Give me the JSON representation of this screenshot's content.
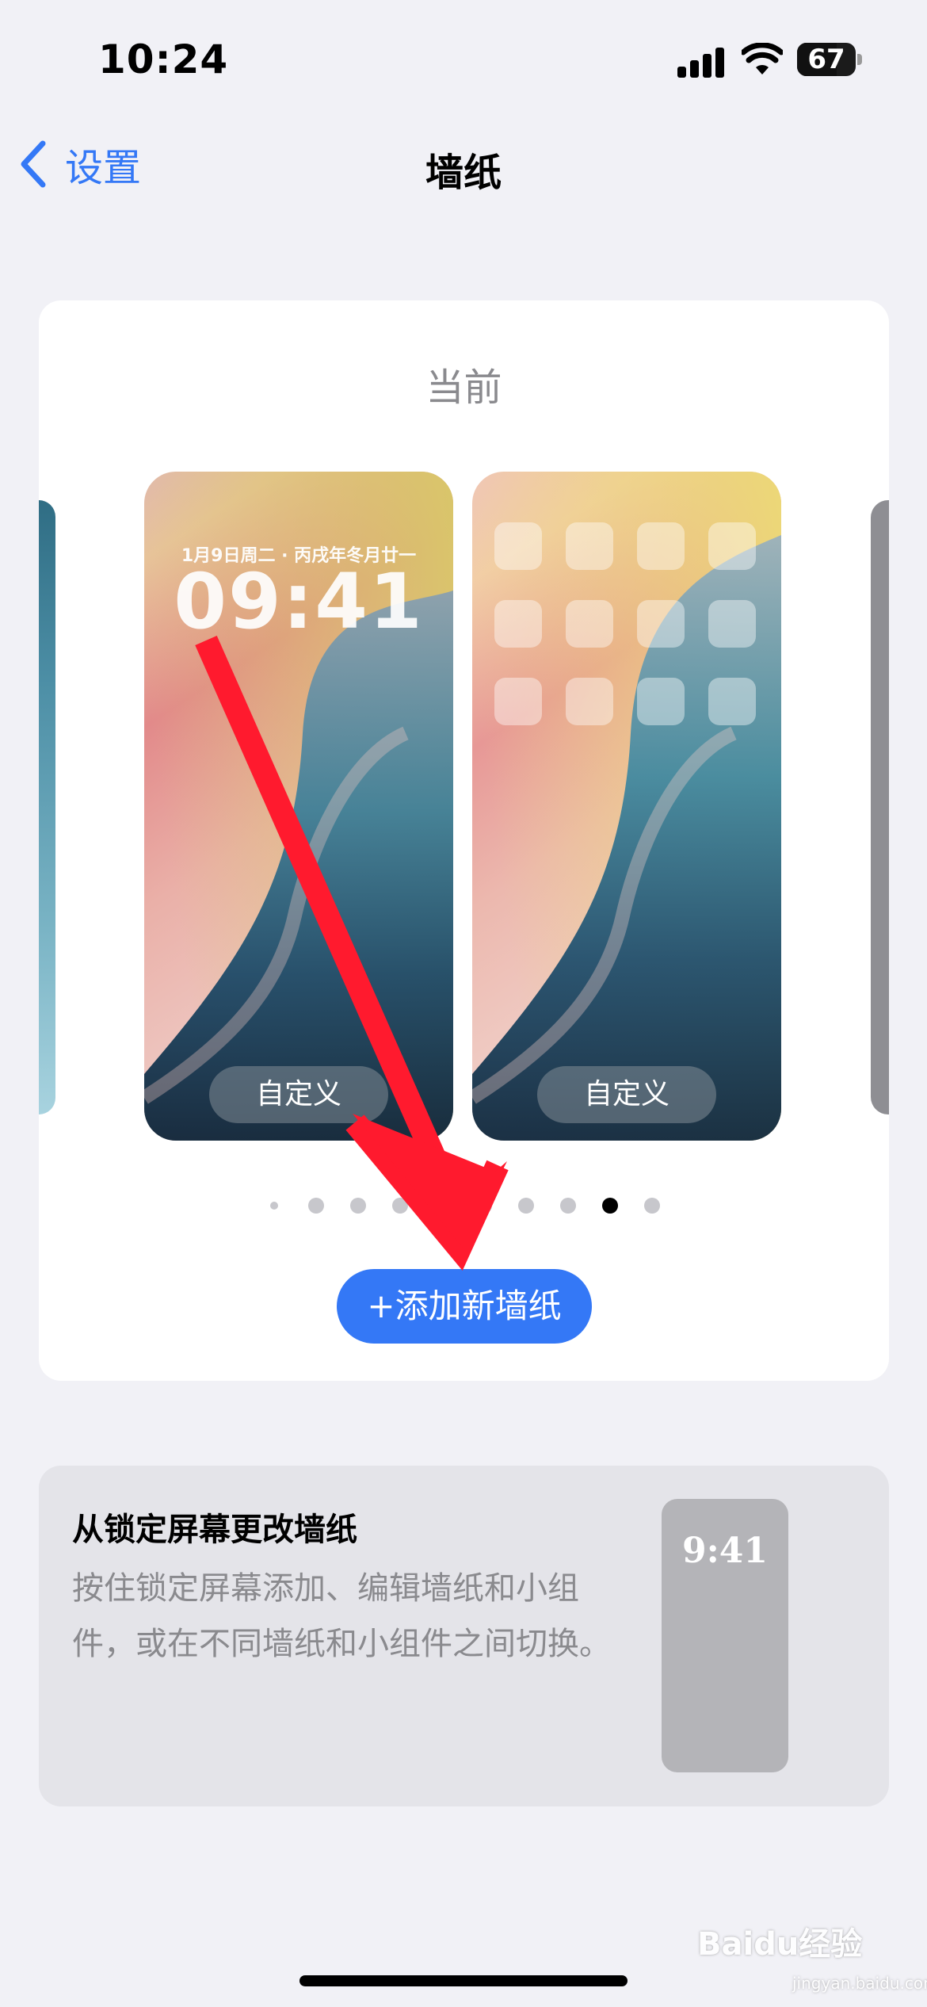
{
  "status_bar": {
    "time": "10:24",
    "battery": "67",
    "icons": [
      "cellular-signal-icon",
      "wifi-icon",
      "battery-icon"
    ]
  },
  "nav": {
    "back_label": "设置",
    "title": "墙纸"
  },
  "current_card": {
    "label": "当前",
    "lock_screen": {
      "date": "1月9日周二 · 丙戌年冬月廿一",
      "time": "09:41",
      "customize_label": "自定义"
    },
    "home_screen": {
      "customize_label": "自定义"
    },
    "page_dots": {
      "count": 10,
      "active_index": 8
    },
    "add_button_label": "+添加新墙纸"
  },
  "info_card": {
    "title": "从锁定屏幕更改墙纸",
    "body": "按住锁定屏幕添加、编辑墙纸和小组件，或在不同墙纸和小组件之间切换。",
    "preview_time": "9:41"
  },
  "watermark": {
    "text": "Baidu经验",
    "sub": "jingyan.baidu.com"
  },
  "colors": {
    "accent": "#3478f6",
    "annotation_arrow": "#ff1a2e",
    "background": "#f1f1f6"
  }
}
